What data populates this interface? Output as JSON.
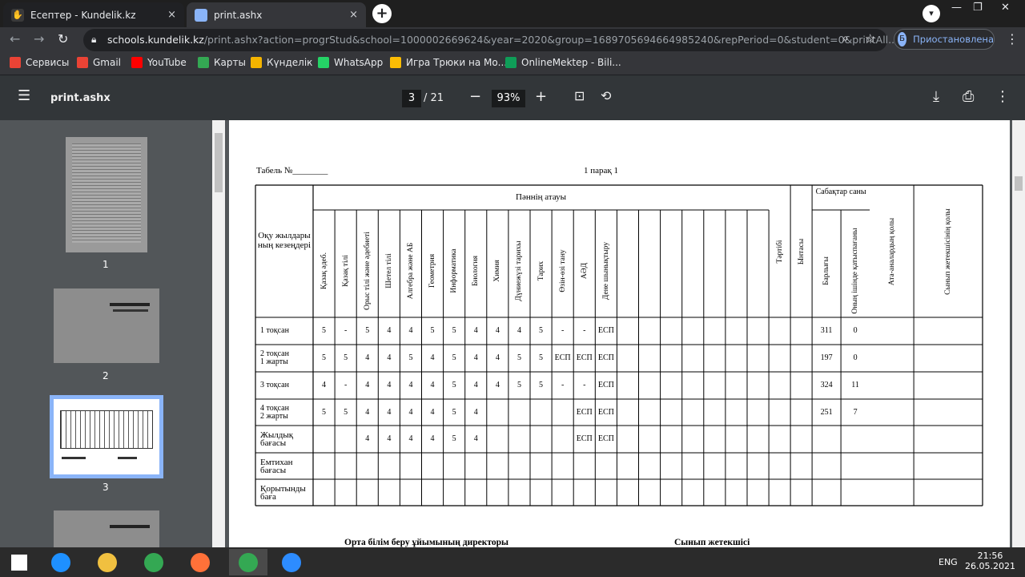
{
  "browser": {
    "tabs": [
      {
        "title": "Есептер - Kundelik.kz",
        "close": "×"
      },
      {
        "title": "print.ashx",
        "close": "×"
      }
    ],
    "new_tab": "+",
    "window_controls": {
      "minimize": "—",
      "maximize": "❐",
      "close": "✕"
    },
    "nav": {
      "back": "←",
      "forward": "→",
      "reload": "↻"
    },
    "url_host": "schools.kundelik.kz",
    "url_rest": "/print.ashx?action=progrStud&school=1000002669624&year=2020&group=1689705694664985240&repPeriod=0&student=0&printAll...",
    "profile": {
      "initial": "Б",
      "label": "Приостановлена"
    },
    "bookmarks": [
      {
        "label": "Сервисы",
        "icon": "apps-grid-icon",
        "color": "#ea4335"
      },
      {
        "label": "Gmail",
        "icon": "gmail-icon",
        "color": "#ea4335"
      },
      {
        "label": "YouTube",
        "icon": "youtube-icon",
        "color": "#ff0000"
      },
      {
        "label": "Карты",
        "icon": "maps-icon",
        "color": "#34a853"
      },
      {
        "label": "Күнделік",
        "icon": "kundelik-icon",
        "color": "#f4b400"
      },
      {
        "label": "WhatsApp",
        "icon": "whatsapp-icon",
        "color": "#25d366"
      },
      {
        "label": "Игра Трюки на Мо...",
        "icon": "game-icon",
        "color": "#fbbc04"
      },
      {
        "label": "OnlineMektep - Bili...",
        "icon": "onlinemektep-icon",
        "color": "#0f9d58"
      }
    ]
  },
  "pdf_viewer": {
    "title": "print.ashx",
    "page_current": "3",
    "page_total": "/ 21",
    "zoom": "93%",
    "thumbnails": [
      "1",
      "2",
      "3"
    ]
  },
  "document": {
    "tabel": "Табель №________",
    "sheet": "1 парақ 1",
    "col_header_main": "Оқу жылдары ның кезеңдері",
    "subject_group": "Пәннің атауы",
    "lessons_group": "Сабақтар саны",
    "subjects": [
      "Қазақ әдеб.",
      "Қазақ тілі",
      "Орыс тілі және әдебиеті",
      "Шетел тілі",
      "Алгебра және АБ",
      "Геометрия",
      "Информатика",
      "Биология",
      "Химия",
      "Дүниежүзі тарихы",
      "Тарих",
      "Өзін-өзі тану",
      "АӘД",
      "Дене шынықтыру"
    ],
    "extra_cols": [
      "Тәртібі",
      "Ынтасы"
    ],
    "lesson_cols": [
      "Барлығы",
      "Оның ішінде қатыспағаны"
    ],
    "sign_cols": [
      "Ата-аналардың қолы",
      "Сынып жетекшісінің қолы"
    ],
    "rows": [
      {
        "label": "1 тоқсан",
        "grades": [
          "5",
          "-",
          "5",
          "4",
          "4",
          "5",
          "5",
          "4",
          "4",
          "4",
          "5",
          "-",
          "-",
          "ЕСП"
        ],
        "total": "311",
        "missed": "0"
      },
      {
        "label": "2 тоқсан\n1 жарты",
        "grades": [
          "5",
          "5",
          "4",
          "4",
          "5",
          "4",
          "5",
          "4",
          "4",
          "5",
          "5",
          "ЕСП",
          "ЕСП",
          "ЕСП"
        ],
        "total": "197",
        "missed": "0"
      },
      {
        "label": "3 тоқсан",
        "grades": [
          "4",
          "-",
          "4",
          "4",
          "4",
          "4",
          "5",
          "4",
          "4",
          "5",
          "5",
          "-",
          "-",
          "ЕСП"
        ],
        "total": "324",
        "missed": "11"
      },
      {
        "label": "4 тоқсан\n2 жарты",
        "grades": [
          "5",
          "5",
          "4",
          "4",
          "4",
          "4",
          "5",
          "4",
          "",
          "",
          "",
          "",
          "ЕСП",
          "ЕСП"
        ],
        "total": "251",
        "missed": "7"
      },
      {
        "label": "Жылдық\nбағасы",
        "grades": [
          "",
          "",
          "4",
          "4",
          "4",
          "4",
          "5",
          "4",
          "",
          "",
          "",
          "",
          "ЕСП",
          "ЕСП"
        ],
        "total": "",
        "missed": ""
      },
      {
        "label": "Емтихан\nбағасы",
        "grades": [
          "",
          "",
          "",
          "",
          "",
          "",
          "",
          "",
          "",
          "",
          "",
          "",
          "",
          ""
        ],
        "total": "",
        "missed": ""
      },
      {
        "label": "Қорытынды\nбаға",
        "grades": [
          "",
          "",
          "",
          "",
          "",
          "",
          "",
          "",
          "",
          "",
          "",
          "",
          "",
          ""
        ],
        "total": "",
        "missed": ""
      }
    ],
    "footer_left": "Орта білім беру ұйымының директоры",
    "footer_right": "Сынып жетекшісі"
  },
  "taskbar": {
    "time": "21:56",
    "date": "26.05.2021",
    "lang": "ENG",
    "apps": [
      "windows-start-icon",
      "internet-explorer-icon",
      "file-explorer-icon",
      "chrome-icon",
      "firefox-icon",
      "chrome-profile-icon",
      "zoom-icon"
    ]
  }
}
